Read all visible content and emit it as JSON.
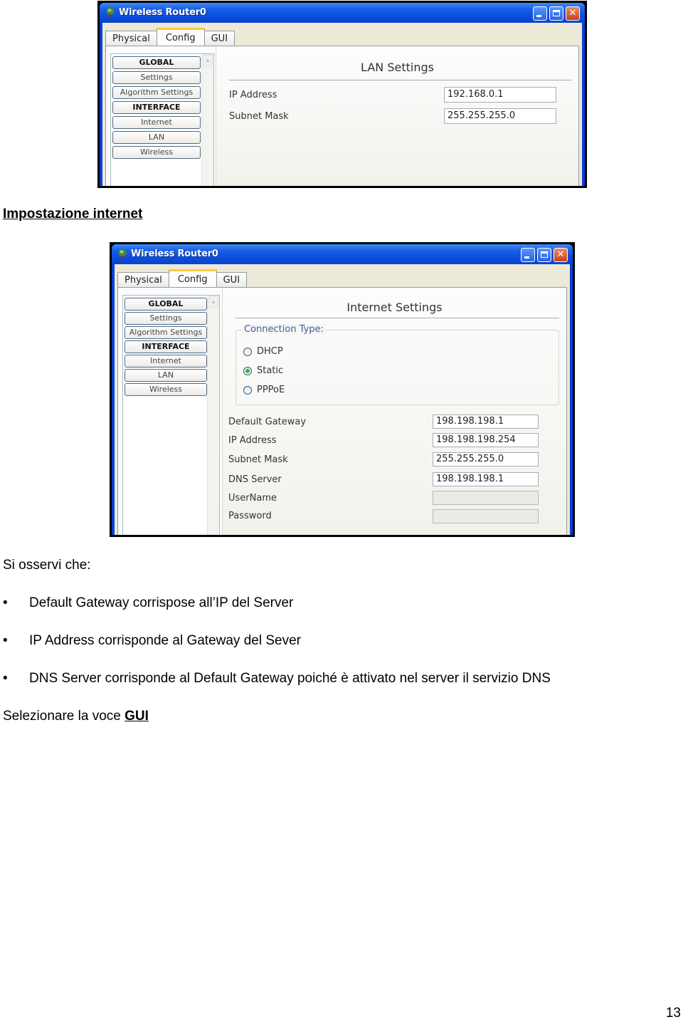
{
  "colors": {
    "titlebar": "#0b4cdc",
    "active_tab_accent": "#ffc83c",
    "legend_text": "#3a5ea8",
    "radio_checked": "#3fae3f"
  },
  "window1": {
    "title": "Wireless Router0",
    "tabs": [
      {
        "label": "Physical",
        "active": false
      },
      {
        "label": "Config",
        "active": true
      },
      {
        "label": "GUI",
        "active": false
      }
    ],
    "sidebar": [
      {
        "label": "GLOBAL",
        "type": "header"
      },
      {
        "label": "Settings",
        "type": "item"
      },
      {
        "label": "Algorithm Settings",
        "type": "item"
      },
      {
        "label": "INTERFACE",
        "type": "header"
      },
      {
        "label": "Internet",
        "type": "item"
      },
      {
        "label": "LAN",
        "type": "item"
      },
      {
        "label": "Wireless",
        "type": "item"
      }
    ],
    "panel_title": "LAN Settings",
    "fields": [
      {
        "label": "IP Address",
        "value": "192.168.0.1"
      },
      {
        "label": "Subnet Mask",
        "value": "255.255.255.0"
      }
    ]
  },
  "section_heading": "Impostazione internet",
  "window2": {
    "title": "Wireless Router0",
    "tabs": [
      {
        "label": "Physical",
        "active": false
      },
      {
        "label": "Config",
        "active": true
      },
      {
        "label": "GUI",
        "active": false
      }
    ],
    "sidebar": [
      {
        "label": "GLOBAL",
        "type": "header"
      },
      {
        "label": "Settings",
        "type": "item"
      },
      {
        "label": "Algorithm Settings",
        "type": "item"
      },
      {
        "label": "INTERFACE",
        "type": "header"
      },
      {
        "label": "Internet",
        "type": "item"
      },
      {
        "label": "LAN",
        "type": "item"
      },
      {
        "label": "Wireless",
        "type": "item"
      }
    ],
    "panel_title": "Internet Settings",
    "connection_type": {
      "legend": "Connection Type:",
      "options": [
        {
          "label": "DHCP",
          "checked": false
        },
        {
          "label": "Static",
          "checked": true
        },
        {
          "label": "PPPoE",
          "checked": false
        }
      ]
    },
    "fields": [
      {
        "label": "Default Gateway",
        "value": "198.198.198.1",
        "disabled": false
      },
      {
        "label": "IP Address",
        "value": "198.198.198.254",
        "disabled": false
      },
      {
        "label": "Subnet Mask",
        "value": "255.255.255.0",
        "disabled": false
      },
      {
        "label": "DNS Server",
        "value": "198.198.198.1",
        "disabled": false
      },
      {
        "label": "UserName",
        "value": "",
        "disabled": true
      },
      {
        "label": "Password",
        "value": "",
        "disabled": true
      }
    ]
  },
  "notes_intro": "Si osservi che:",
  "bullet_char": "•",
  "bullets": [
    "Default Gateway corrispose all’IP del Server",
    "IP Address corrisponde al Gateway del Sever",
    "DNS Server corrisponde al Default Gateway poiché è attivato nel server il servizio DNS"
  ],
  "instruction": {
    "prefix": "Selezionare la voce ",
    "link": "GUI"
  },
  "page_number": "13"
}
